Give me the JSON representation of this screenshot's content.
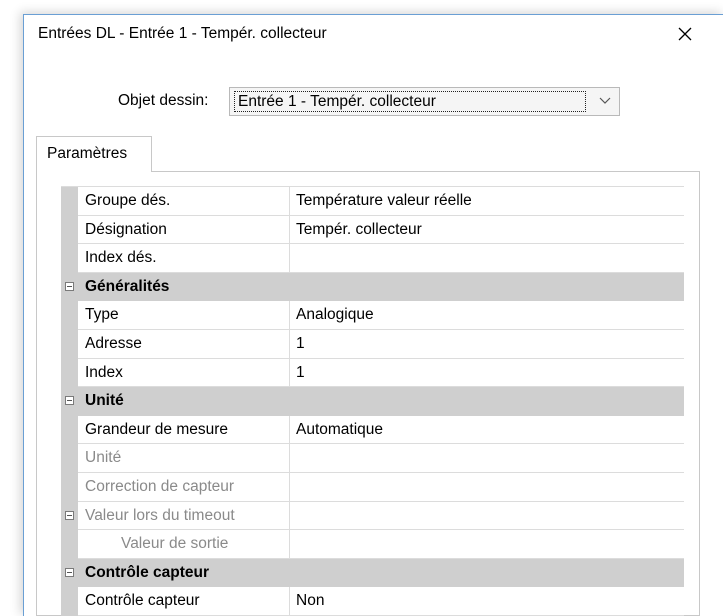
{
  "window": {
    "title": "Entrées DL - Entrée 1 - Tempér. collecteur",
    "close_icon": "close-icon"
  },
  "objet_dessin": {
    "label": "Objet dessin:",
    "value": "Entrée 1 - Tempér. collecteur"
  },
  "tabs": [
    {
      "label": "Paramètres",
      "active": true
    }
  ],
  "grid": {
    "rows": [
      {
        "kind": "prop",
        "name": "Groupe dés.",
        "value": "Température valeur réelle"
      },
      {
        "kind": "prop",
        "name": "Désignation",
        "value": "Tempér. collecteur"
      },
      {
        "kind": "prop",
        "name": "Index dés.",
        "value": ""
      },
      {
        "kind": "cat",
        "name": "Généralités"
      },
      {
        "kind": "prop",
        "name": "Type",
        "value": "Analogique"
      },
      {
        "kind": "prop",
        "name": "Adresse",
        "value": "1"
      },
      {
        "kind": "prop",
        "name": "Index",
        "value": "1"
      },
      {
        "kind": "cat",
        "name": "Unité"
      },
      {
        "kind": "prop",
        "name": "Grandeur de mesure",
        "value": "Automatique"
      },
      {
        "kind": "prop",
        "name": "Unité",
        "value": "",
        "disabled": true
      },
      {
        "kind": "prop",
        "name": "Correction de capteur",
        "value": "",
        "disabled": true
      },
      {
        "kind": "prop",
        "name": "Valeur lors du timeout",
        "value": "",
        "disabled": true,
        "expander": true
      },
      {
        "kind": "prop",
        "name": "Valeur de sortie",
        "value": "",
        "disabled": true,
        "indent": true
      },
      {
        "kind": "cat",
        "name": "Contrôle capteur"
      },
      {
        "kind": "prop",
        "name": "Contrôle capteur",
        "value": "Non"
      }
    ]
  }
}
